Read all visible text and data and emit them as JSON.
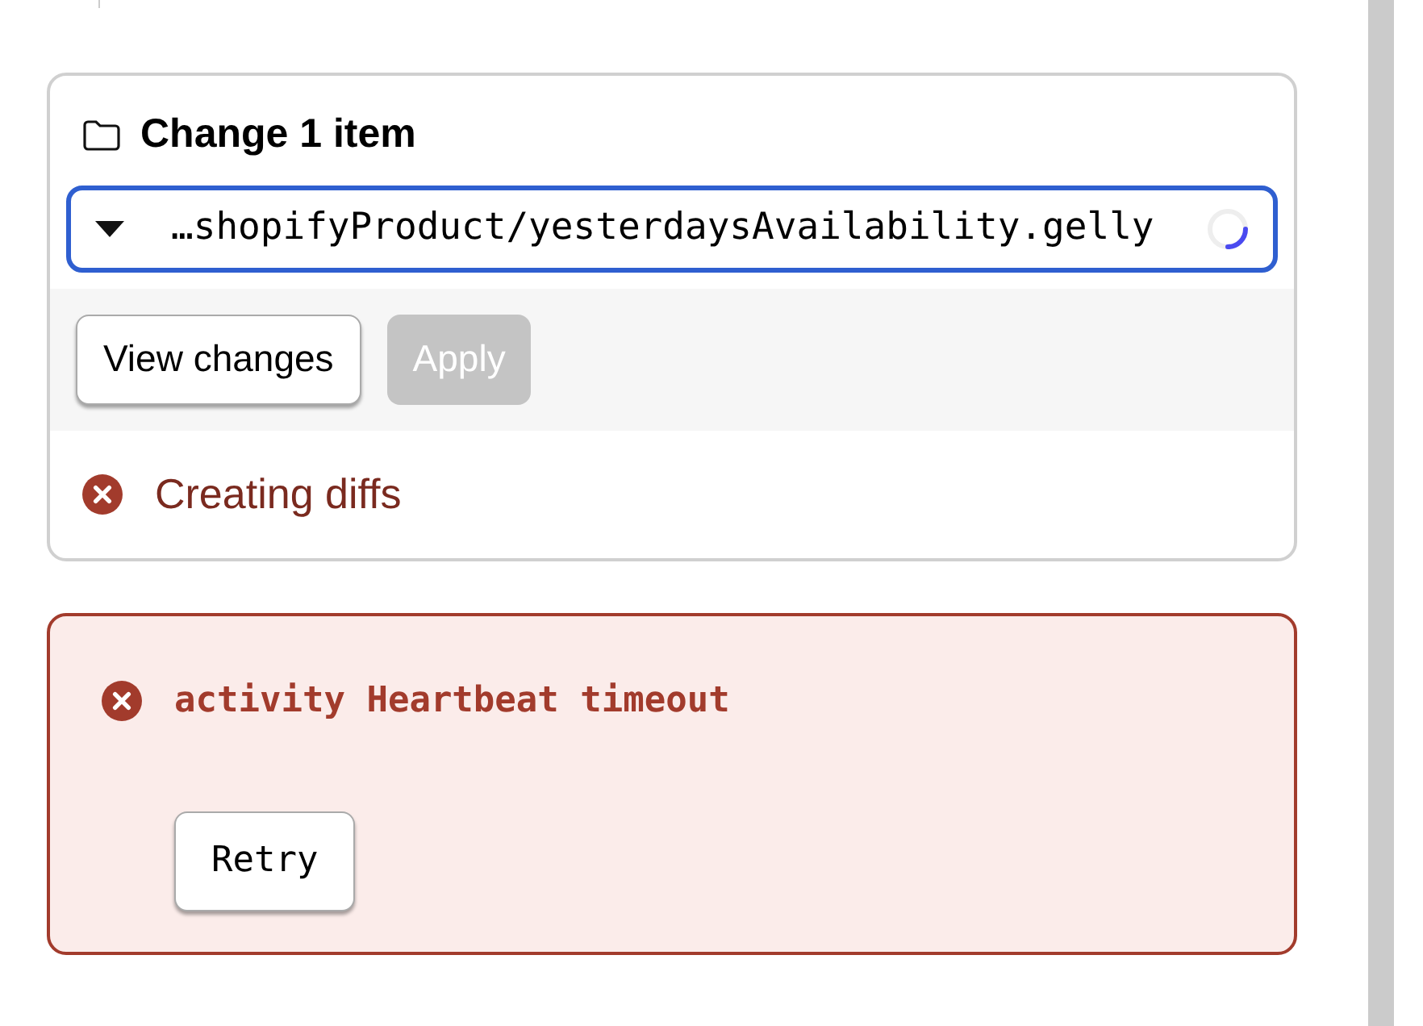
{
  "change_panel": {
    "title": "Change 1 item",
    "file": {
      "path": "…shopifyProduct/yesterdaysAvailability.gelly",
      "loading": true
    },
    "buttons": [
      {
        "label": "View changes",
        "disabled": false
      },
      {
        "label": "Apply",
        "disabled": true
      }
    ],
    "status": {
      "kind": "error",
      "text": "Creating diffs"
    }
  },
  "error_box": {
    "message": "activity Heartbeat timeout",
    "button": "Retry"
  }
}
